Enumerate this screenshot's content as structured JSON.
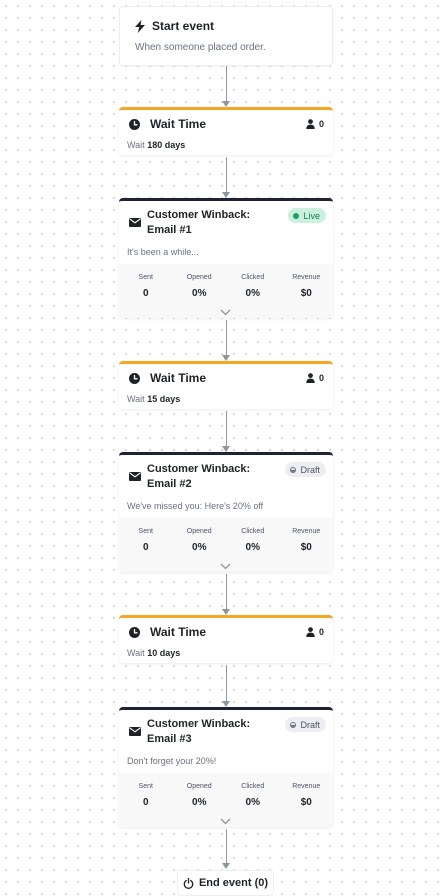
{
  "start": {
    "title": "Start event",
    "description": "When someone placed order."
  },
  "waits": [
    {
      "title": "Wait Time",
      "count": "0",
      "prefix": "Wait",
      "duration": "180 days"
    },
    {
      "title": "Wait Time",
      "count": "0",
      "prefix": "Wait",
      "duration": "15 days"
    },
    {
      "title": "Wait Time",
      "count": "0",
      "prefix": "Wait",
      "duration": "10 days"
    }
  ],
  "emails": [
    {
      "title": "Customer Winback: Email #1",
      "status": "Live",
      "subject": "It's been a while...",
      "stats": {
        "sent": "0",
        "opened": "0%",
        "clicked": "0%",
        "revenue": "$0"
      }
    },
    {
      "title": "Customer Winback: Email #2",
      "status": "Draft",
      "subject": "We've missed you: Here's 20% off",
      "stats": {
        "sent": "0",
        "opened": "0%",
        "clicked": "0%",
        "revenue": "$0"
      }
    },
    {
      "title": "Customer Winback: Email #3",
      "status": "Draft",
      "subject": "Don't forget your 20%!",
      "stats": {
        "sent": "0",
        "opened": "0%",
        "clicked": "0%",
        "revenue": "$0"
      }
    }
  ],
  "stat_labels": {
    "sent": "Sent",
    "opened": "Opened",
    "clicked": "Clicked",
    "revenue": "Revenue"
  },
  "end": {
    "label": "End event (0)"
  },
  "colors": {
    "wait_accent": "#f5a623",
    "email_accent": "#1e2336",
    "live_badge_bg": "#c9f1dd",
    "draft_badge_bg": "#eceef1"
  },
  "icons": {
    "start": "lightning-bolt-icon",
    "wait": "clock-icon",
    "people": "person-icon",
    "email": "envelope-icon",
    "expand": "chevron-down-icon",
    "end": "power-icon"
  }
}
